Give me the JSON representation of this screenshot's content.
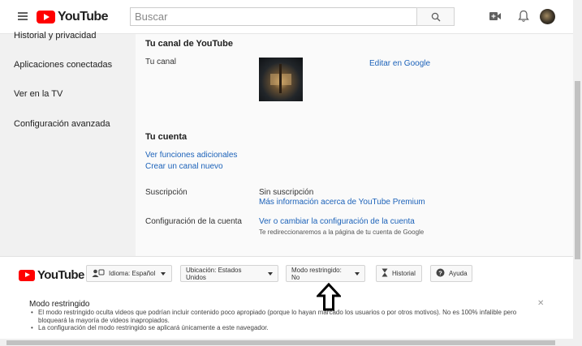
{
  "header": {
    "logo_text": "YouTube",
    "search_placeholder": "Buscar"
  },
  "sidebar": {
    "items": [
      {
        "label": "Historial y privacidad"
      },
      {
        "label": "Aplicaciones conectadas"
      },
      {
        "label": "Ver en la TV"
      },
      {
        "label": "Configuración avanzada"
      }
    ]
  },
  "channel_section": {
    "title": "Tu canal de YouTube",
    "row_label": "Tu canal",
    "edit_link": "Editar en Google"
  },
  "account_section": {
    "title": "Tu cuenta",
    "links": [
      "Ver funciones adicionales",
      "Crear un canal nuevo"
    ],
    "subscription_label": "Suscripción",
    "subscription_value": "Sin suscripción",
    "premium_link": "Más información acerca de YouTube Premium",
    "settings_label": "Configuración de la cuenta",
    "settings_link": "Ver o cambiar la configuración de la cuenta",
    "settings_note": "Te redireccionaremos a la página de tu cuenta de Google"
  },
  "footer": {
    "logo_text": "YouTube",
    "language_btn": "Idioma: Español",
    "location_btn": "Ubicación: Estados Unidos",
    "restricted_btn": "Modo restringido: No",
    "history_btn": "Historial",
    "help_btn": "Ayuda"
  },
  "restricted_panel": {
    "title": "Modo restringido",
    "bullets": [
      "El modo restringido oculta videos que podrían incluir contenido poco apropiado (porque lo hayan marcado los usuarios o por otros motivos). No es 100% infalible pero bloqueará la mayoría de videos inapropiados.",
      "La configuración del modo restringido se aplicará únicamente a este navegador."
    ],
    "close_symbol": "✕"
  },
  "colors": {
    "brand_red": "#ff0000",
    "link_blue": "#1c62b9",
    "sidebar_bg": "#f1f1f1"
  }
}
